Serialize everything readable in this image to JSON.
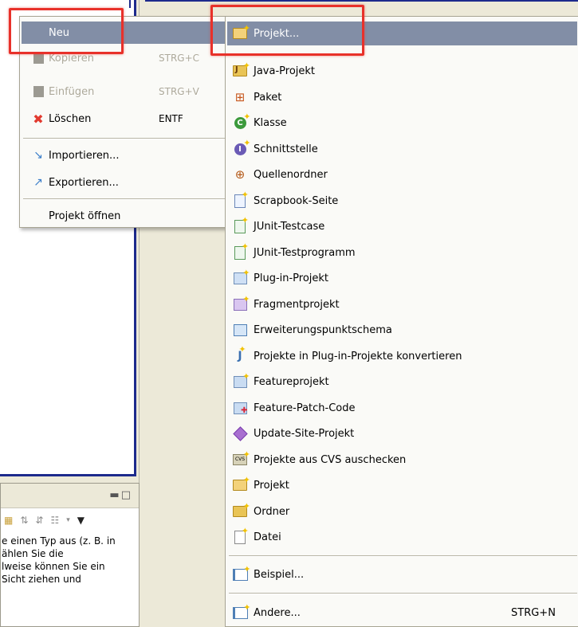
{
  "context_menu": {
    "items": [
      {
        "label": "Neu",
        "shortcut": "",
        "icon": "none",
        "state": "highlighted"
      },
      {
        "label": "Kopieren",
        "shortcut": "STRG+C",
        "icon": "copy-icon",
        "state": "disabled"
      },
      {
        "label": "Einfügen",
        "shortcut": "STRG+V",
        "icon": "paste-icon",
        "state": "disabled"
      },
      {
        "label": "Löschen",
        "shortcut": "ENTF",
        "icon": "delete-icon",
        "state": "enabled"
      },
      {
        "label": "Importieren...",
        "shortcut": "",
        "icon": "import-icon",
        "state": "enabled"
      },
      {
        "label": "Exportieren...",
        "shortcut": "",
        "icon": "export-icon",
        "state": "enabled"
      },
      {
        "label": "Projekt öffnen",
        "shortcut": "",
        "icon": "none",
        "state": "enabled"
      }
    ]
  },
  "submenu": {
    "items": [
      {
        "label": "Projekt...",
        "icon": "new-project-icon",
        "state": "highlighted"
      },
      {
        "label": "Java-Projekt",
        "icon": "java-project-icon"
      },
      {
        "label": "Paket",
        "icon": "package-icon"
      },
      {
        "label": "Klasse",
        "icon": "class-icon"
      },
      {
        "label": "Schnittstelle",
        "icon": "interface-icon"
      },
      {
        "label": "Quellenordner",
        "icon": "source-folder-icon"
      },
      {
        "label": "Scrapbook-Seite",
        "icon": "scrapbook-page-icon"
      },
      {
        "label": "JUnit-Testcase",
        "icon": "junit-testcase-icon"
      },
      {
        "label": "JUnit-Testprogramm",
        "icon": "junit-testsuite-icon"
      },
      {
        "label": "Plug-in-Projekt",
        "icon": "plugin-project-icon"
      },
      {
        "label": "Fragmentprojekt",
        "icon": "fragment-project-icon"
      },
      {
        "label": "Erweiterungspunktschema",
        "icon": "extension-point-schema-icon"
      },
      {
        "label": "Projekte in Plug-in-Projekte konvertieren",
        "icon": "convert-projects-icon"
      },
      {
        "label": "Featureprojekt",
        "icon": "feature-project-icon"
      },
      {
        "label": "Feature-Patch-Code",
        "icon": "feature-patch-icon"
      },
      {
        "label": "Update-Site-Projekt",
        "icon": "update-site-project-icon"
      },
      {
        "label": "Projekte aus CVS auschecken",
        "icon": "cvs-checkout-icon"
      },
      {
        "label": "Projekt",
        "icon": "project-icon"
      },
      {
        "label": "Ordner",
        "icon": "folder-icon"
      },
      {
        "label": "Datei",
        "icon": "file-icon"
      },
      {
        "label": "Beispiel...",
        "icon": "example-icon"
      },
      {
        "label": "Andere...",
        "icon": "other-icon",
        "shortcut": "STRG+N"
      }
    ]
  },
  "hint_panel": {
    "lines": [
      "e einen Typ aus (z. B. in",
      "ählen Sie die",
      "lweise können Sie ein",
      "Sicht ziehen und"
    ]
  },
  "colors": {
    "highlight": "#828ea6",
    "callout": "#e8312a",
    "menu_background": "#fafaf7",
    "disabled_text": "#aca899",
    "window_border": "#1d2a8c"
  }
}
